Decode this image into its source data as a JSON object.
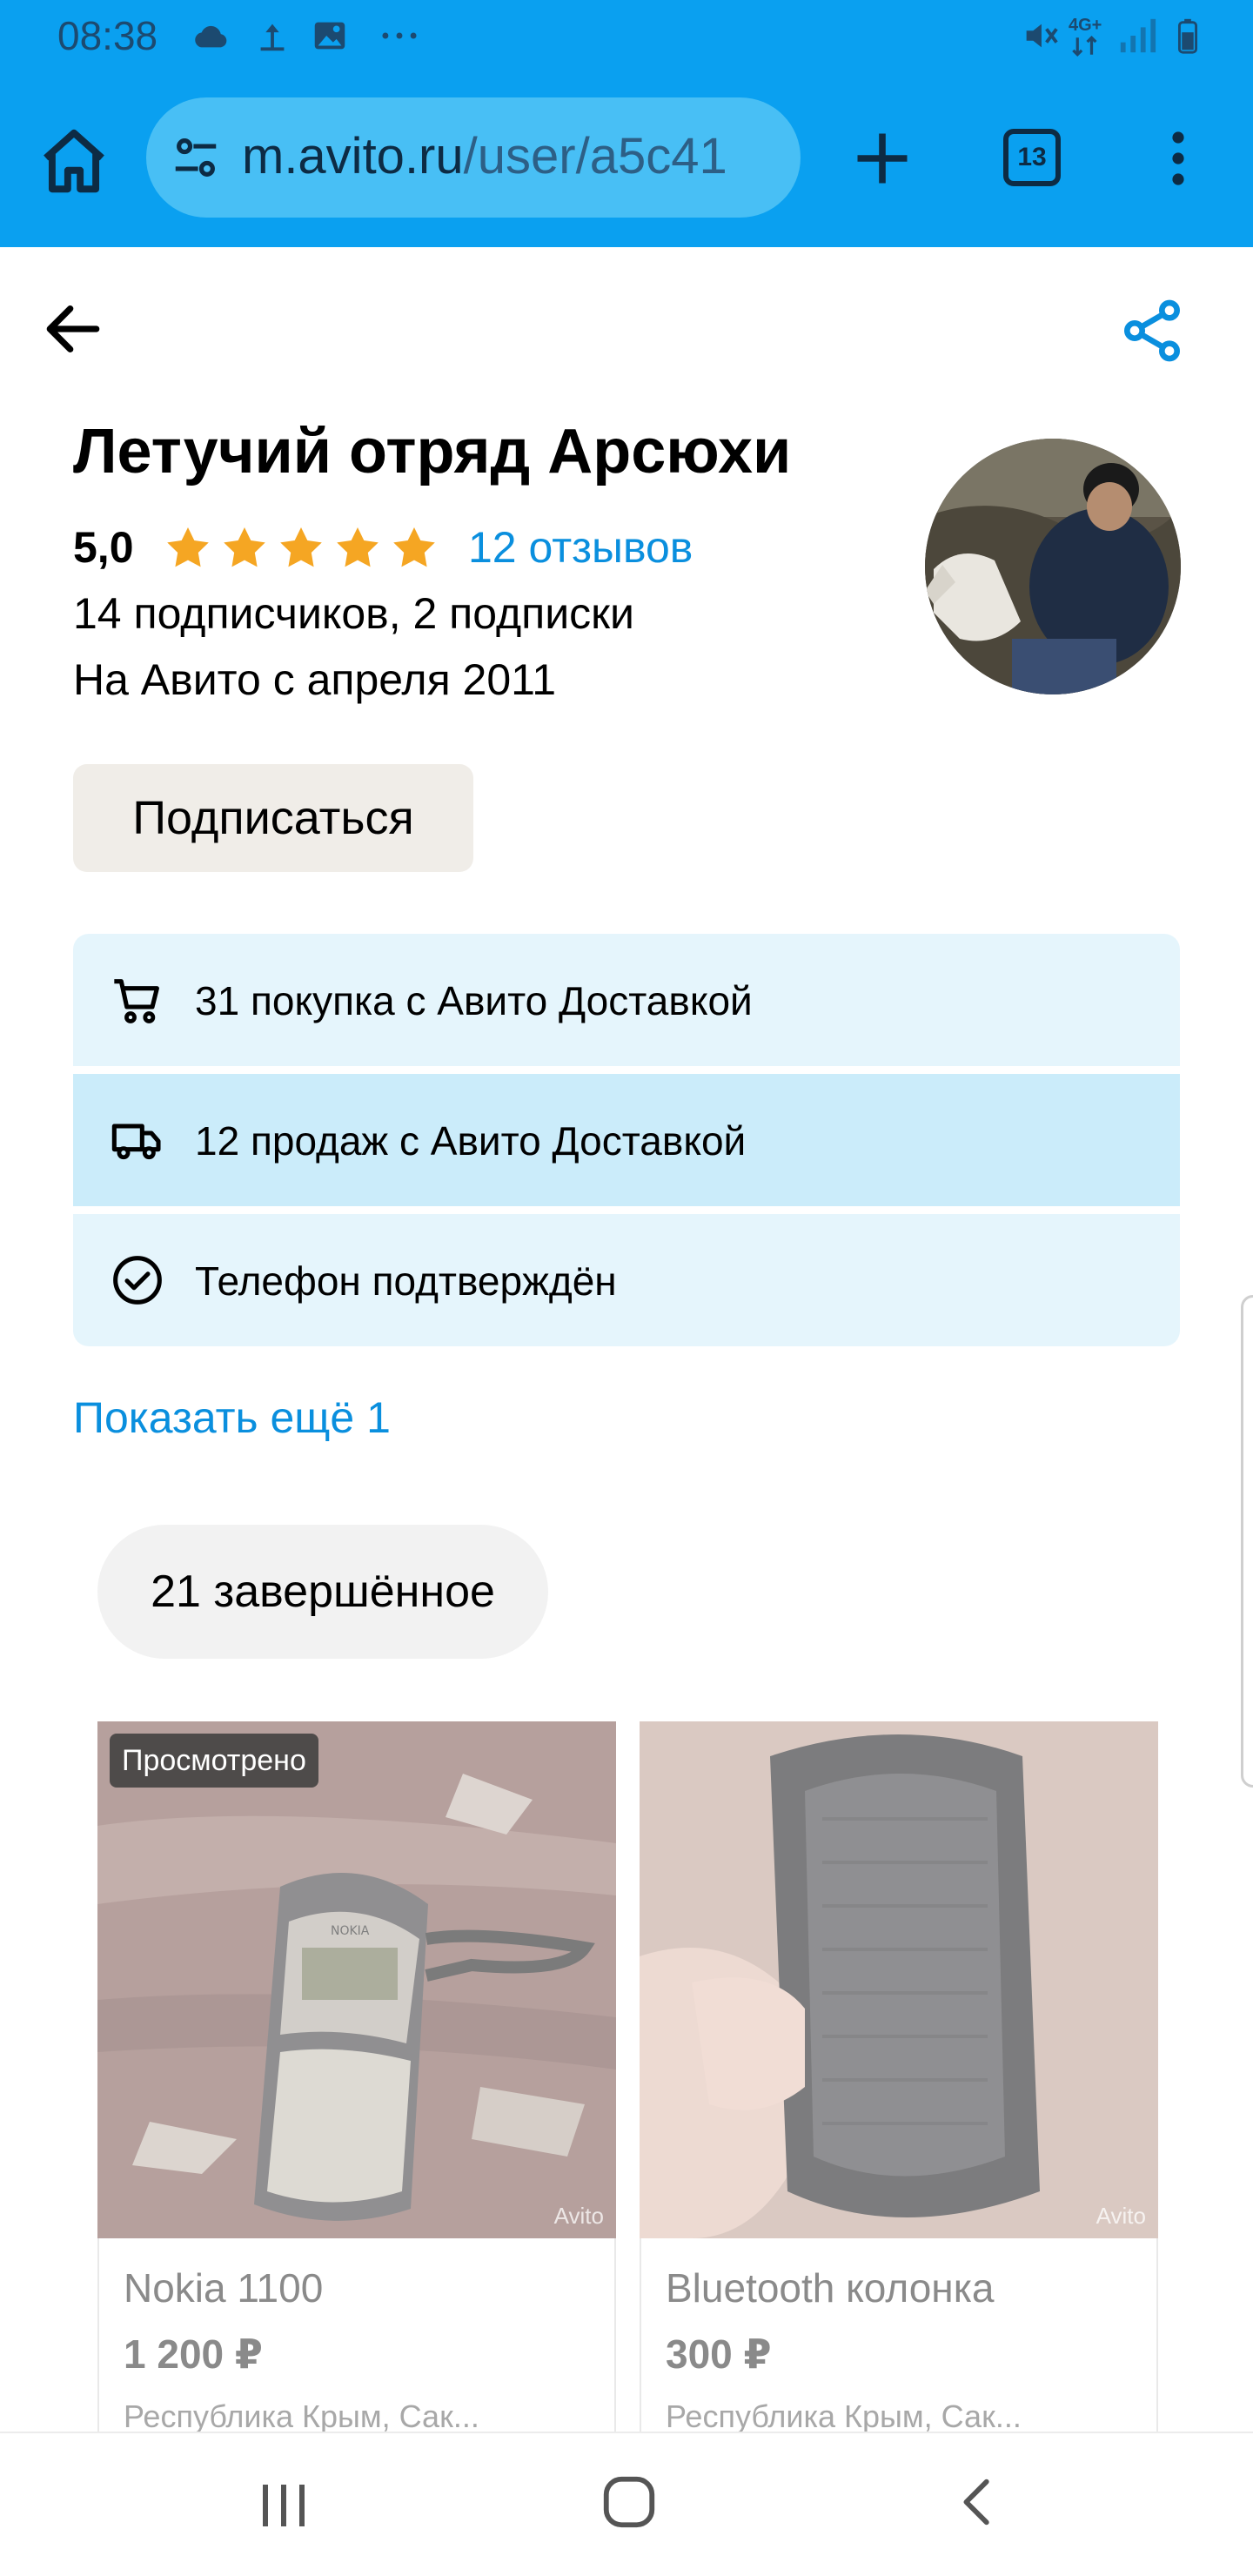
{
  "status_bar": {
    "time": "08:38",
    "left_icons": [
      "cloud-icon",
      "upload-icon",
      "image-icon",
      "more-dots-icon"
    ],
    "right_icons": [
      "mute-vibrate-icon",
      "network-4g-icon",
      "signal-icon",
      "battery-icon"
    ],
    "network_label": "4G+"
  },
  "browser": {
    "url_domain": "m.avito.ru",
    "url_path": "/user/a5c41",
    "tab_count": "13",
    "accent": "#0aa0f0"
  },
  "profile": {
    "name": "Летучий отряд Арсюхи",
    "rating": "5,0",
    "stars": 5,
    "reviews_link": "12 отзывов",
    "subscribers": "14 подписчиков, 2 подписки",
    "since": "На Авито с апреля 2011",
    "subscribe_label": "Подписаться"
  },
  "info_rows": [
    {
      "icon": "cart-icon",
      "text": "31 покупка с Авито Доставкой"
    },
    {
      "icon": "truck-icon",
      "text": "12 продаж с Авито Доставкой"
    },
    {
      "icon": "check-circle-icon",
      "text": "Телефон подтверждён"
    }
  ],
  "show_more": "Показать ещё 1",
  "completed_filter": "21 завершённое",
  "listings": [
    {
      "badge": "Просмотрено",
      "watermark": "Avito",
      "name": "Nokia 1100",
      "price": "1 200 ₽",
      "location": "Республика Крым, Сак..."
    },
    {
      "badge": "",
      "watermark": "Avito",
      "name": "Bluetooth колонка",
      "price": "300 ₽",
      "location": "Республика Крым, Сак..."
    }
  ],
  "colors": {
    "link": "#0a8fde",
    "star": "#f5a623",
    "info_bg": "#e5f5fc",
    "info_bg_highlight": "#cbecfa"
  }
}
